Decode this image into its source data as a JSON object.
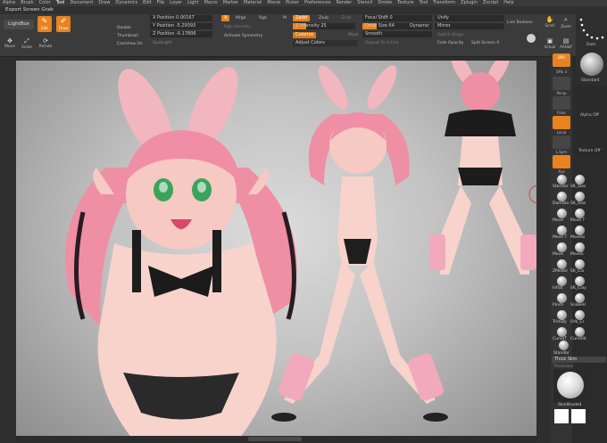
{
  "menu": [
    "Alpha",
    "Brush",
    "Color",
    "Tool",
    "Document",
    "Draw",
    "Dynamics",
    "Edit",
    "File",
    "Layer",
    "Light",
    "Macro",
    "Marker",
    "Material",
    "Movie",
    "Picker",
    "Preferences",
    "Render",
    "Stencil",
    "Stroke",
    "Texture",
    "Tool",
    "Transform",
    "Zplugin",
    "Zscript",
    "Help"
  ],
  "menu_active_index": 3,
  "title": "Export Screen Grab",
  "shelf": {
    "lightbox": "LightBox",
    "edit": "Edit",
    "draw": "Draw",
    "move": "Move",
    "scale": "Scale",
    "rotate": "Rotate",
    "double": "Double",
    "thumbnail": "Thumbnail",
    "camview": "CamView On",
    "x_pos_label": "X Position",
    "x_pos_value": "0.00167",
    "y_pos_label": "Y Position",
    "y_pos_value": "-5.29393",
    "z_pos_label": "Z Position",
    "z_pos_value": "-0.17806",
    "spotlight": "SpotLight",
    "a_button": "A",
    "mrgb": "Mrgb",
    "rgb": "Rgb",
    "m": "M",
    "zadd": "Zadd",
    "zsub": "Zsub",
    "zcut": "Zcut",
    "rgb_intensity": "Rgb Intensity",
    "z_intensity_label": "Z Intensity",
    "z_intensity_value": "25",
    "activate_symmetry": "Activate Symmetry",
    "colorize": "Colorize",
    "mask": "Mask",
    "adjust_colors": "Adjust Colors",
    "focal_shift_label": "Focal Shift",
    "focal_shift_value": "0",
    "draw_size_label": "Draw Size",
    "draw_size_value": "64",
    "dynamic": "Dynamic",
    "smooth": "Smooth",
    "repeat_active": "Repeat To Active",
    "unify": "Unify",
    "mirror": "Mirror",
    "switch_stage": "Switch Stage",
    "fade_opacity": "Fade Opacity",
    "split_screen_label": "Split Screen",
    "split_screen_value": "0",
    "live_boolean": "Live Boolean",
    "scroll": "Scroll",
    "zoom": "Zoom",
    "actual": "Actual",
    "aahalf": "AAHalf",
    "dots": "Dots",
    "standard": "Standard",
    "alpha_off": "Alpha Off",
    "texture_off": "Texture Off"
  },
  "right_vertical": {
    "bpr": "BPR",
    "spix_label": "SPix",
    "spix_value": "3",
    "persp": "Persp",
    "floor": "Floor",
    "local": "Local",
    "lsym": "L.Sym",
    "xyz": "Xyz"
  },
  "brushes": [
    {
      "label": "Standar"
    },
    {
      "label": "SK_Slas"
    },
    {
      "label": "DamSta"
    },
    {
      "label": "SK_Slas"
    },
    {
      "label": "Move"
    },
    {
      "label": "Move T"
    },
    {
      "label": "Move T"
    },
    {
      "label": "Movebi"
    },
    {
      "label": "Move"
    },
    {
      "label": "MoveE"
    },
    {
      "label": "ZModel"
    },
    {
      "label": "SK_Clo"
    },
    {
      "label": "Inflat"
    },
    {
      "label": "SK_Clay"
    },
    {
      "label": "Pinch"
    },
    {
      "label": "SnakeH"
    },
    {
      "label": "TrimDy"
    },
    {
      "label": "Orb_Cr"
    },
    {
      "label": "CurveT"
    },
    {
      "label": "CurveSt"
    }
  ],
  "tray_bottom": {
    "standard2": "Standar",
    "thick_skin": "Thick Skin",
    "thickness": "Thickness",
    "material": "SkinShade4"
  },
  "colors": {
    "accent": "#e8831f",
    "panel": "#3b3b3b",
    "dark": "#2b2b2b"
  }
}
